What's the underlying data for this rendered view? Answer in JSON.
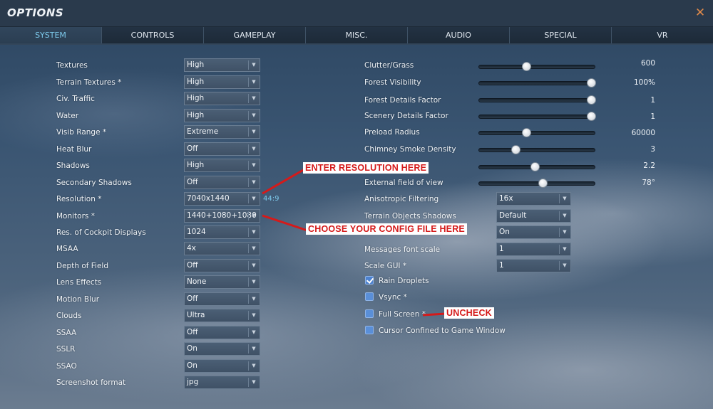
{
  "window": {
    "title": "OPTIONS",
    "close_label": "✕"
  },
  "tabs": [
    {
      "label": "SYSTEM",
      "active": true
    },
    {
      "label": "CONTROLS"
    },
    {
      "label": "GAMEPLAY"
    },
    {
      "label": "MISC."
    },
    {
      "label": "AUDIO"
    },
    {
      "label": "SPECIAL"
    },
    {
      "label": "VR"
    }
  ],
  "left_settings": [
    {
      "label": "Textures",
      "value": "High"
    },
    {
      "label": "Terrain Textures *",
      "value": "High"
    },
    {
      "label": "Civ. Traffic",
      "value": "High"
    },
    {
      "label": "Water",
      "value": "High"
    },
    {
      "label": "Visib Range *",
      "value": "Extreme"
    },
    {
      "label": "Heat Blur",
      "value": "Off"
    },
    {
      "label": "Shadows",
      "value": "High"
    },
    {
      "label": "Secondary Shadows",
      "value": "Off"
    },
    {
      "label": "Resolution *",
      "value": "7040x1440"
    },
    {
      "label": "Monitors *",
      "value": "1440+1080+1080"
    },
    {
      "label": "Res. of Cockpit Displays",
      "value": "1024"
    },
    {
      "label": "MSAA",
      "value": "4x"
    },
    {
      "label": "Depth of Field",
      "value": "Off"
    },
    {
      "label": "Lens Effects",
      "value": "None"
    },
    {
      "label": "Motion Blur",
      "value": "Off"
    },
    {
      "label": "Clouds",
      "value": "Ultra"
    },
    {
      "label": "SSAA",
      "value": "Off"
    },
    {
      "label": "SSLR",
      "value": "On"
    },
    {
      "label": "SSAO",
      "value": "On"
    },
    {
      "label": "Screenshot format",
      "value": "jpg"
    }
  ],
  "aspect_ratio": "44:9",
  "sliders": [
    {
      "label": "Clutter/Grass",
      "value": "600",
      "level": 0.4
    },
    {
      "label": "Forest Visibility",
      "value": "100%",
      "level": 1.0
    },
    {
      "label": "Forest Details Factor",
      "value": "1",
      "level": 1.0
    },
    {
      "label": "Scenery Details Factor",
      "value": "1",
      "level": 1.0
    },
    {
      "label": "Preload Radius",
      "value": "60000",
      "level": 0.4
    },
    {
      "label": "Chimney Smoke Density",
      "value": "3",
      "level": 0.3
    },
    {
      "label": "",
      "value": "2.2",
      "level": 0.48
    },
    {
      "label": "External field of view",
      "value": "78°",
      "level": 0.55
    }
  ],
  "right_selects": [
    {
      "label": "Anisotropic Filtering",
      "value": "16x"
    },
    {
      "label": "Terrain Objects Shadows",
      "value": "Default"
    },
    {
      "label": "",
      "value": "On"
    },
    {
      "label": "Messages font scale",
      "value": "1"
    },
    {
      "label": "Scale GUI *",
      "value": "1"
    }
  ],
  "checkboxes": [
    {
      "label": "Rain Droplets",
      "checked": true
    },
    {
      "label": "Vsync *",
      "checked": false
    },
    {
      "label": "Full Screen *",
      "checked": false
    },
    {
      "label": "Cursor Confined to Game Window",
      "checked": false
    }
  ],
  "annotations": {
    "resolution": "ENTER RESOLUTION HERE",
    "config": "CHOOSE YOUR CONFIG FILE HERE",
    "uncheck": "UNCHECK"
  },
  "colors": {
    "accent": "#7cc8ea",
    "annotation_text": "#d51a1a",
    "arrow": "#d51a1a"
  }
}
